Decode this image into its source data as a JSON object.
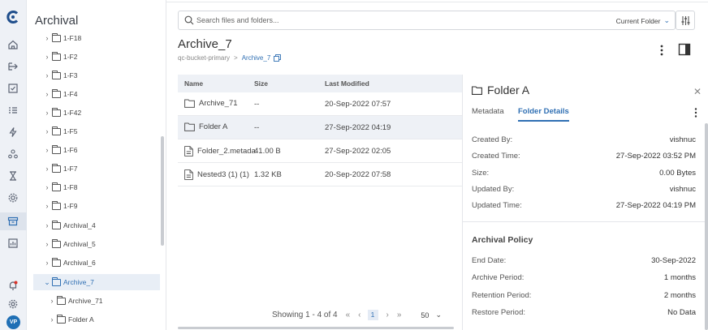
{
  "rail": {
    "avatar_initials": "VP",
    "accent": "#2f6fb3"
  },
  "tree": {
    "title": "Archival",
    "items": [
      {
        "label": "1-F18"
      },
      {
        "label": "1-F2"
      },
      {
        "label": "1-F3"
      },
      {
        "label": "1-F4"
      },
      {
        "label": "1-F42"
      },
      {
        "label": "1-F5"
      },
      {
        "label": "1-F6"
      },
      {
        "label": "1-F7"
      },
      {
        "label": "1-F8"
      },
      {
        "label": "1-F9"
      },
      {
        "label": "Archival_4"
      },
      {
        "label": "Archival_5"
      },
      {
        "label": "Archival_6"
      },
      {
        "label": "Archive_7"
      },
      {
        "label": "Archive_71"
      },
      {
        "label": "Folder A"
      }
    ]
  },
  "search": {
    "placeholder": "Search files and folders...",
    "scope": "Current Folder"
  },
  "header": {
    "title": "Archive_7",
    "breadcrumb_root": "qc-bucket-primary",
    "breadcrumb_sep": ">",
    "breadcrumb_current": "Archive_7"
  },
  "table": {
    "columns": [
      "Name",
      "Size",
      "Last Modified"
    ],
    "rows": [
      {
        "name": "Archive_71",
        "size": "--",
        "modified": "20-Sep-2022 07:57",
        "type": "folder"
      },
      {
        "name": "Folder A",
        "size": "--",
        "modified": "27-Sep-2022 04:19",
        "type": "folder"
      },
      {
        "name": "Folder_2.metadata",
        "size": "41.00 B",
        "modified": "27-Sep-2022 02:05",
        "type": "file"
      },
      {
        "name": "Nested3 (1) (1)",
        "size": "1.32 KB",
        "modified": "20-Sep-2022 07:58",
        "type": "file"
      }
    ]
  },
  "pager": {
    "showing": "Showing 1 - 4 of 4",
    "first": "«",
    "prev": "‹",
    "page": "1",
    "next": "›",
    "last": "»",
    "rows_per_page": "50"
  },
  "details": {
    "title": "Folder A",
    "tabs": [
      "Metadata",
      "Folder Details"
    ],
    "fields": [
      {
        "key": "Created By:",
        "value": "vishnuc"
      },
      {
        "key": "Created Time:",
        "value": "27-Sep-2022 03:52 PM"
      },
      {
        "key": "Size:",
        "value": "0.00 Bytes"
      },
      {
        "key": "Updated By:",
        "value": "vishnuc"
      },
      {
        "key": "Updated Time:",
        "value": "27-Sep-2022 04:19 PM"
      }
    ],
    "policy_title": "Archival Policy",
    "policy": [
      {
        "key": "End Date:",
        "value": "30-Sep-2022"
      },
      {
        "key": "Archive Period:",
        "value": "1 months"
      },
      {
        "key": "Retention Period:",
        "value": "2 months"
      },
      {
        "key": "Restore Period:",
        "value": "No Data"
      }
    ]
  }
}
